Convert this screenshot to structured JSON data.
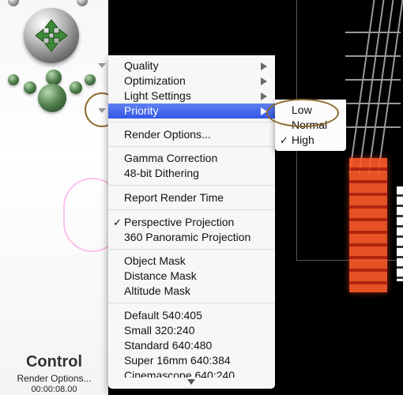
{
  "control_panel": {
    "title": "Control",
    "subtitle": "Render Options...",
    "time": "00:00:08.00"
  },
  "menu": {
    "items": [
      {
        "label": "Quality",
        "submenu": true
      },
      {
        "label": "Optimization",
        "submenu": true
      },
      {
        "label": "Light Settings",
        "submenu": true
      },
      {
        "label": "Priority",
        "submenu": true,
        "highlighted": true
      },
      {
        "label": "Render Options..."
      },
      {
        "label": "Gamma Correction"
      },
      {
        "label": "48-bit Dithering"
      },
      {
        "label": "Report Render Time"
      },
      {
        "label": "Perspective Projection",
        "checked": true
      },
      {
        "label": "360 Panoramic Projection"
      },
      {
        "label": "Object Mask"
      },
      {
        "label": "Distance Mask"
      },
      {
        "label": "Altitude Mask"
      },
      {
        "label": "Default 540:405"
      },
      {
        "label": "Small 320:240"
      },
      {
        "label": "Standard 640:480"
      },
      {
        "label": "Super 16mm 640:384"
      },
      {
        "label": "Cinemascope 640:240"
      }
    ]
  },
  "submenu": {
    "items": [
      {
        "label": "Low"
      },
      {
        "label": "Normal"
      },
      {
        "label": "High",
        "checked": true
      }
    ],
    "check_glyph": "✓"
  },
  "colors": {
    "highlight": "#3a5fe8",
    "annotation_ring": "#8a6a2a"
  }
}
